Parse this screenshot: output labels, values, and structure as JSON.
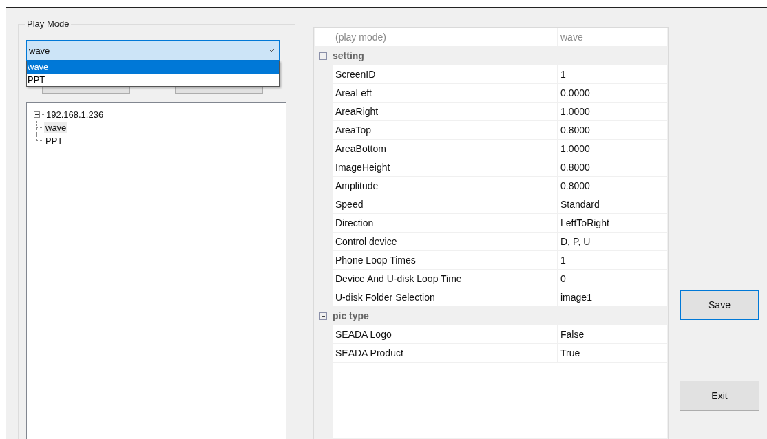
{
  "play_mode": {
    "label": "Play Mode",
    "combo": {
      "value": "wave",
      "expanded": true,
      "options": [
        {
          "label": "wave",
          "selected": true
        },
        {
          "label": "PPT",
          "selected": false
        }
      ]
    }
  },
  "tree": {
    "items": [
      {
        "label": "192.168.1.236",
        "expanded": true,
        "selected": false,
        "children": [
          {
            "label": "wave",
            "selected": true
          },
          {
            "label": "PPT",
            "selected": false
          }
        ]
      }
    ]
  },
  "property_grid": {
    "header": {
      "name": "(play mode)",
      "value": "wave"
    },
    "categories": [
      {
        "label": "setting",
        "expanded": true,
        "properties": [
          {
            "name": "ScreenID",
            "value": "1"
          },
          {
            "name": "AreaLeft",
            "value": "0.0000"
          },
          {
            "name": "AreaRight",
            "value": "1.0000"
          },
          {
            "name": "AreaTop",
            "value": "0.8000"
          },
          {
            "name": "AreaBottom",
            "value": "1.0000"
          },
          {
            "name": "ImageHeight",
            "value": "0.8000"
          },
          {
            "name": "Amplitude",
            "value": "0.8000"
          },
          {
            "name": "Speed",
            "value": "Standard"
          },
          {
            "name": "Direction",
            "value": "LeftToRight"
          },
          {
            "name": "Control device",
            "value": "D, P, U"
          },
          {
            "name": "Phone Loop Times",
            "value": "1"
          },
          {
            "name": "Device And U-disk Loop Time",
            "value": "0"
          },
          {
            "name": "U-disk Folder Selection",
            "value": "image1"
          }
        ]
      },
      {
        "label": "pic type",
        "expanded": true,
        "properties": [
          {
            "name": "SEADA Logo",
            "value": "False"
          },
          {
            "name": "SEADA Product",
            "value": "True"
          }
        ]
      }
    ]
  },
  "buttons": [
    {
      "label": "Save",
      "focused": true
    },
    {
      "label": "Exit",
      "focused": false
    }
  ]
}
